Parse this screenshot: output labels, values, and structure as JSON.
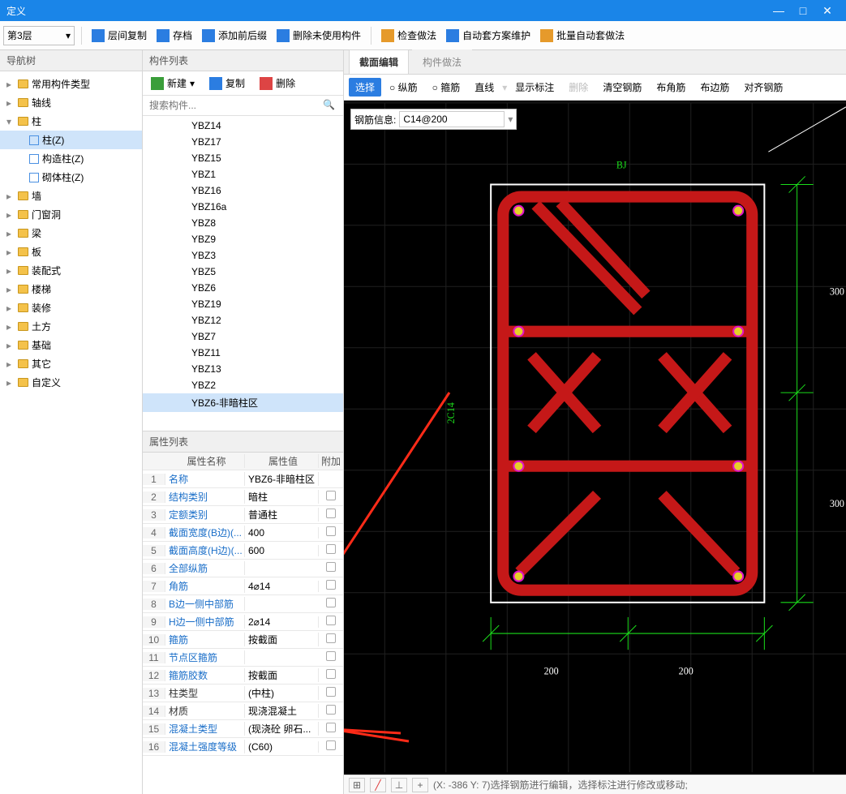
{
  "window": {
    "title": "定义"
  },
  "floor_selector": {
    "value": "第3层"
  },
  "top_toolbar": [
    {
      "id": "layer-copy",
      "label": "层间复制"
    },
    {
      "id": "archive",
      "label": "存档"
    },
    {
      "id": "add-prefix-suffix",
      "label": "添加前后缀"
    },
    {
      "id": "delete-unused",
      "label": "删除未使用构件"
    },
    {
      "id": "sep"
    },
    {
      "id": "check-method",
      "label": "检查做法"
    },
    {
      "id": "auto-scheme-maintain",
      "label": "自动套方案维护"
    },
    {
      "id": "batch-auto-method",
      "label": "批量自动套做法"
    }
  ],
  "nav": {
    "header": "导航树",
    "items": [
      {
        "label": "常用构件类型",
        "folder": true
      },
      {
        "label": "轴线",
        "folder": true
      },
      {
        "label": "柱",
        "folder": true,
        "expanded": true,
        "children": [
          {
            "label": "柱(Z)",
            "selected": true
          },
          {
            "label": "构造柱(Z)"
          },
          {
            "label": "砌体柱(Z)"
          }
        ]
      },
      {
        "label": "墙",
        "folder": true
      },
      {
        "label": "门窗洞",
        "folder": true
      },
      {
        "label": "梁",
        "folder": true
      },
      {
        "label": "板",
        "folder": true
      },
      {
        "label": "装配式",
        "folder": true
      },
      {
        "label": "楼梯",
        "folder": true
      },
      {
        "label": "装修",
        "folder": true
      },
      {
        "label": "土方",
        "folder": true
      },
      {
        "label": "基础",
        "folder": true
      },
      {
        "label": "其它",
        "folder": true
      },
      {
        "label": "自定义",
        "folder": true
      }
    ]
  },
  "components": {
    "header": "构件列表",
    "toolbar": {
      "new": "新建",
      "copy": "复制",
      "delete": "删除"
    },
    "search_placeholder": "搜索构件...",
    "items": [
      "YBZ14",
      "YBZ17",
      "YBZ15",
      "YBZ1",
      "YBZ16",
      "YBZ16a",
      "YBZ8",
      "YBZ9",
      "YBZ3",
      "YBZ5",
      "YBZ6",
      "YBZ19",
      "YBZ12",
      "YBZ7",
      "YBZ11",
      "YBZ13",
      "YBZ2",
      "YBZ6-非暗柱区"
    ],
    "selected": "YBZ6-非暗柱区"
  },
  "properties": {
    "header": "属性列表",
    "columns": {
      "name": "属性名称",
      "value": "属性值",
      "attach": "附加"
    },
    "rows": [
      {
        "n": "名称",
        "v": "YBZ6-非暗柱区"
      },
      {
        "n": "结构类别",
        "v": "暗柱"
      },
      {
        "n": "定额类别",
        "v": "普通柱"
      },
      {
        "n": "截面宽度(B边)(...",
        "v": "400"
      },
      {
        "n": "截面高度(H边)(...",
        "v": "600"
      },
      {
        "n": "全部纵筋",
        "v": ""
      },
      {
        "n": "角筋",
        "v": "4⌀14"
      },
      {
        "n": "B边一侧中部筋",
        "v": ""
      },
      {
        "n": "H边一侧中部筋",
        "v": "2⌀14"
      },
      {
        "n": "箍筋",
        "v": "按截面"
      },
      {
        "n": "节点区箍筋",
        "v": ""
      },
      {
        "n": "箍筋胶数",
        "v": "按截面"
      },
      {
        "n": "柱类型",
        "v": "(中柱)"
      },
      {
        "n": "材质",
        "v": "现浇混凝土"
      },
      {
        "n": "混凝土类型",
        "v": "(现浇砼 卵石..."
      },
      {
        "n": "混凝土强度等级",
        "v": "(C60)"
      }
    ]
  },
  "right": {
    "tabs": {
      "section_edit": "截面编辑",
      "comp_method": "构件做法"
    },
    "toolbar": {
      "select": "选择",
      "vbar": "纵筋",
      "stirrup": "箍筋",
      "line": "直线",
      "show_label": "显示标注",
      "delete": "删除",
      "clear_rebar": "清空钢筋",
      "corner_rebar": "布角筋",
      "edge_rebar": "布边筋",
      "align_rebar": "对齐钢筋"
    },
    "rebar_info": {
      "label": "钢筋信息:",
      "value": "C14@200"
    },
    "canvas": {
      "top_label": "BJ",
      "left_label": "2C14",
      "dim_right_1": "300",
      "dim_right_2": "300",
      "dim_bot_1": "200",
      "dim_bot_2": "200"
    },
    "status": "(X: -386 Y: 7)选择钢筋进行编辑，选择标注进行修改或移动;"
  }
}
